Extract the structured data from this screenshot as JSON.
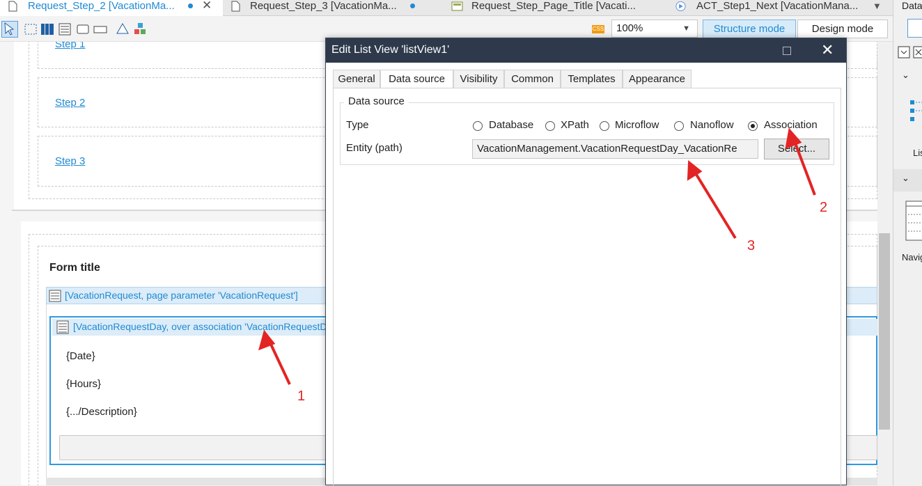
{
  "tabs": [
    {
      "label": "Request_Step_2 [VacationMa...",
      "modified": true,
      "active": true
    },
    {
      "label": "Request_Step_3 [VacationMa...",
      "modified": true,
      "active": false
    },
    {
      "label": "Request_Step_Page_Title [Vacati...",
      "modified": false,
      "active": false
    },
    {
      "label": "ACT_Step1_Next [VacationMana...",
      "modified": false,
      "active": false
    }
  ],
  "right_panel": {
    "title": "Data",
    "list_label": "Lis",
    "nav_label": "Navig"
  },
  "toolbar": {
    "css_badge": "CSS",
    "zoom": "100%",
    "structure_mode": "Structure mode",
    "design_mode": "Design mode"
  },
  "canvas": {
    "steps": [
      "Step 1",
      "Step 2",
      "Step 3"
    ],
    "form_title": "Form title",
    "dataview_header": "[VacationRequest, page parameter 'VacationRequest']",
    "listview_header": "[VacationRequestDay, over association 'VacationRequestD",
    "fields": [
      "{Date}",
      "{Hours}",
      "{.../Description}"
    ]
  },
  "dialog": {
    "title": "Edit List View 'listView1'",
    "tabs": [
      "General",
      "Data source",
      "Visibility",
      "Common",
      "Templates",
      "Appearance"
    ],
    "active_tab": "Data source",
    "group_title": "Data source",
    "type_label": "Type",
    "type_options": [
      "Database",
      "XPath",
      "Microflow",
      "Nanoflow",
      "Association"
    ],
    "type_selected": "Association",
    "entity_label": "Entity (path)",
    "entity_value": "VacationManagement.VacationRequestDay_VacationRe",
    "select_button": "Select..."
  },
  "annotations": [
    "1",
    "2",
    "3"
  ],
  "colors": {
    "accent": "#1f8ad3",
    "dialog_header": "#2e3a4b",
    "annotation": "#e32424"
  }
}
